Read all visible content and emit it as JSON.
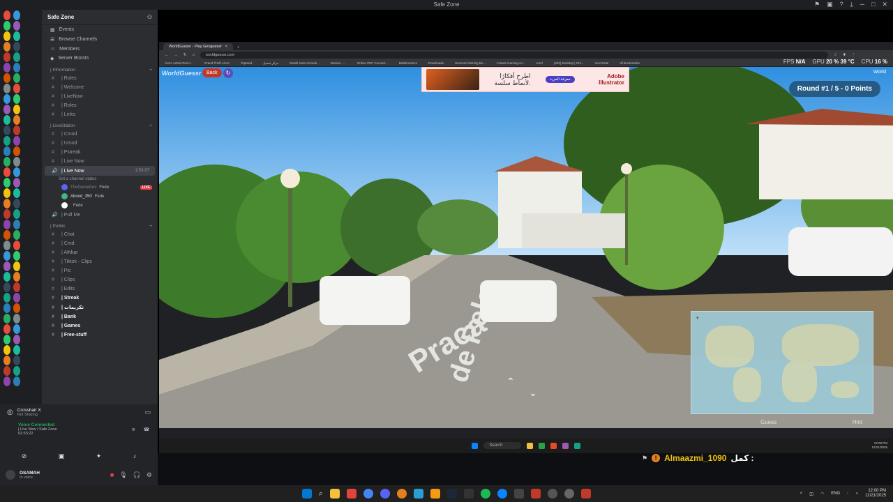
{
  "window": {
    "title": "Safe Zone"
  },
  "server": {
    "name": "Safe Zone",
    "top_items": [
      "Events",
      "Browse Channels",
      "Members",
      "Server Boosts"
    ],
    "categories": [
      {
        "name": "| Information",
        "channels": [
          "| Roles",
          "| Welcome",
          "| LiveNow",
          "| Roles",
          "| Links"
        ]
      },
      {
        "name": "| LiveStation",
        "channels": [
          "| Cmod",
          "| Umod",
          "| Pstreak",
          "| Live Now"
        ]
      }
    ],
    "active_channel": {
      "name": "| Live Now",
      "time": "2:53:07",
      "status": "Set a channel status"
    },
    "voice_users": [
      {
        "name": "TheGameDev",
        "tag": "Fede",
        "live": "LIVE"
      },
      {
        "name": "Abood_350",
        "tag": "Fede",
        "live": ""
      },
      {
        "name": "",
        "tag": "Fede",
        "live": ""
      }
    ],
    "pull_me": "| Pull Me",
    "public_category": "| Public",
    "public_channels": [
      "| Chat",
      "| Cmd",
      "| Athkar",
      "| Tiktok - Clips",
      "| Pic",
      "| Clips",
      "| Edits",
      "| Streak",
      "| تكريمات",
      "| Bank",
      "| Games",
      "| Free-stuff"
    ]
  },
  "now_playing": {
    "title": "Crosshair X",
    "sub": "Not Sharing"
  },
  "voice": {
    "status": "Voice Connected",
    "where": "| Live Now / Safe Zone",
    "timer": "02:53:22"
  },
  "user": {
    "name": "OSAMAH",
    "status": "In voice"
  },
  "browser": {
    "tab": "WorldGuessr - Play Geoguessr",
    "url": "worldguessr.com",
    "bookmarks": [
      "ArmA AdminTool A...",
      "Grand Theft ArmA",
      "TopMod",
      "مركز تحميل",
      "Death Note Animati...",
      "Movies - ...",
      "Online PDF Convert...",
      "Battlemetrics",
      "Downloads",
      "Sencent Gaming Bu...",
      "Instant-Gaming.co...",
      "eXel",
      "(403) Desktop | Onl...",
      "VirusTotal",
      "All Bookmarks"
    ]
  },
  "hud": {
    "fps_label": "FPS",
    "fps": "N/A",
    "gpu_label": "GPU",
    "gpu_pct": "20 %",
    "gpu_temp": "39 °C",
    "cpu_label": "CPU",
    "cpu_pct": "16 %"
  },
  "game": {
    "logo": "WorldGuessr",
    "back": "Back",
    "round": "Round #1 / 5 - 0 Points",
    "world": "World",
    "ad_title": "اطرح أفكارًا",
    "ad_sub": "لأنماط سلسة.",
    "ad_btn": "معرفة المزيد",
    "ad_brand": "Adobe Illustrator",
    "street_line1": "Praca V",
    "street_line2": "de Pele",
    "guess": "Guess",
    "hint": "Hint"
  },
  "inner_taskbar": {
    "search": "Search",
    "time": "12:00 PM",
    "date": "12/21/2025"
  },
  "chat": {
    "user": "Almaazmi_1090",
    "msg": "كمل :"
  },
  "taskbar": {
    "lang": "ENG",
    "time": "12:00 PM",
    "date": "12/21/2025"
  },
  "colors": {
    "accent": "#5865f2",
    "live": "#ed4245",
    "voice": "#23a55a",
    "round_bg": "#1f4b6e"
  }
}
